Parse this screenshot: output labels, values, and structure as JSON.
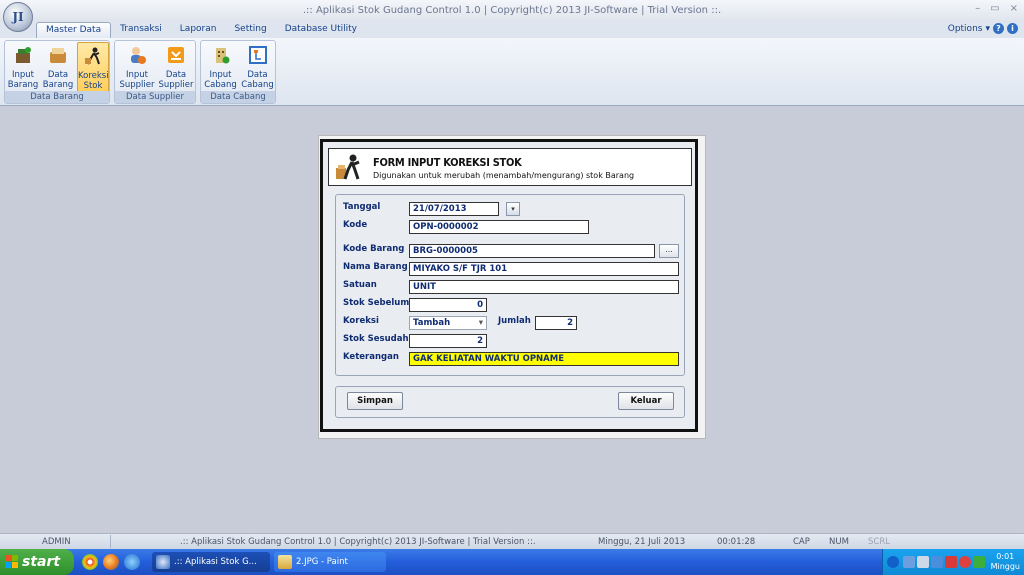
{
  "window": {
    "title": ".:: Aplikasi Stok Gudang Control 1.0   |  Copyright(c) 2013 JI-Software   |  Trial Version ::.",
    "orb_label": "JI",
    "min": "–",
    "restore": "▭",
    "close": "×"
  },
  "menu": {
    "tabs": [
      "Master Data",
      "Transaksi",
      "Laporan",
      "Setting",
      "Database Utility"
    ],
    "options_label": "Options",
    "options_arrow": "▾"
  },
  "ribbon": {
    "groups": [
      {
        "label": "Data Barang",
        "buttons": [
          {
            "line1": "Input",
            "line2": "Barang"
          },
          {
            "line1": "Data",
            "line2": "Barang"
          },
          {
            "line1": "Koreksi",
            "line2": "Stok"
          }
        ]
      },
      {
        "label": "Data Supplier",
        "buttons": [
          {
            "line1": "Input",
            "line2": "Supplier"
          },
          {
            "line1": "Data",
            "line2": "Supplier"
          }
        ]
      },
      {
        "label": "Data Cabang",
        "buttons": [
          {
            "line1": "Input",
            "line2": "Cabang"
          },
          {
            "line1": "Data",
            "line2": "Cabang"
          }
        ]
      }
    ]
  },
  "form": {
    "title": "FORM INPUT KOREKSI STOK",
    "subtitle": "Digunakan untuk merubah (menambah/mengurang) stok Barang",
    "labels": {
      "tanggal": "Tanggal",
      "kode": "Kode",
      "kode_barang": "Kode Barang",
      "nama_barang": "Nama Barang",
      "satuan": "Satuan",
      "stok_sebelum": "Stok Sebelum",
      "koreksi": "Koreksi",
      "jumlah": "Jumlah",
      "stok_sesudah": "Stok Sesudah",
      "keterangan": "Keterangan"
    },
    "values": {
      "tanggal": "21/07/2013",
      "kode": "OPN-0000002",
      "kode_barang": "BRG-0000005",
      "nama_barang": "MIYAKO S/F TJR 101",
      "satuan": "UNIT",
      "stok_sebelum": "0",
      "koreksi": "Tambah",
      "jumlah": "2",
      "stok_sesudah": "2",
      "keterangan": "GAK KELIATAN WAKTU OPNAME"
    },
    "browse_label": "...",
    "dropdown_arrow": "▾",
    "simpan": "Simpan",
    "keluar": "Keluar"
  },
  "statusbar": {
    "user": "ADMIN",
    "app": ".:: Aplikasi Stok Gudang Control 1.0  |  Copyright(c) 2013 JI-Software  |  Trial Version ::.",
    "date": "Minggu, 21 Juli 2013",
    "time": "00:01:28",
    "cap": "CAP",
    "num": "NUM",
    "scrl": "SCRL"
  },
  "taskbar": {
    "start": "start",
    "tasks": [
      ".:: Aplikasi Stok G...",
      "2.JPG - Paint"
    ],
    "clock_time": "0:01",
    "clock_day": "Minggu"
  },
  "colors": {
    "accent": "#15428b",
    "highlight": "#ffff00",
    "taskbar": "#245edb"
  }
}
